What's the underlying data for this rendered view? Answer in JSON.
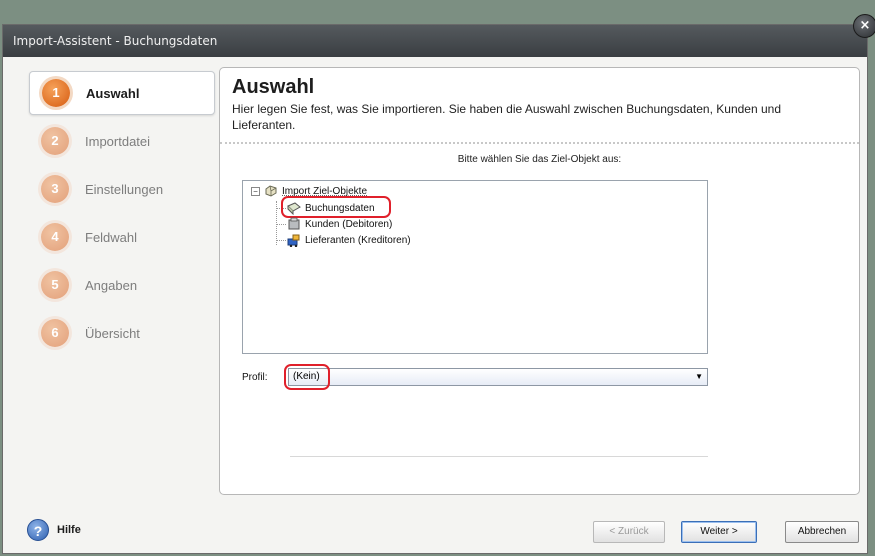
{
  "window": {
    "title": "Import-Assistent - Buchungsdaten",
    "close_glyph": "×"
  },
  "sidebar": {
    "steps": [
      {
        "number": "1",
        "label": "Auswahl",
        "state": "active"
      },
      {
        "number": "2",
        "label": "Importdatei",
        "state": "inactive"
      },
      {
        "number": "3",
        "label": "Einstellungen",
        "state": "inactive"
      },
      {
        "number": "4",
        "label": "Feldwahl",
        "state": "inactive"
      },
      {
        "number": "5",
        "label": "Angaben",
        "state": "inactive"
      },
      {
        "number": "6",
        "label": "Übersicht",
        "state": "inactive"
      }
    ]
  },
  "main": {
    "title": "Auswahl",
    "description": "Hier legen Sie fest, was Sie importieren. Sie haben die Auswahl zwischen Buchungsdaten, Kunden und Lieferanten.",
    "instruction": "Bitte wählen Sie das Ziel-Objekt aus:",
    "tree": {
      "root": {
        "label": "Import Ziel-Objekte",
        "icon": "puzzle-icon",
        "expander": "−"
      },
      "children": [
        {
          "label": "Buchungsdaten",
          "icon": "book-icon",
          "selected": true
        },
        {
          "label": "Kunden (Debitoren)",
          "icon": "customer-icon",
          "selected": false
        },
        {
          "label": "Lieferanten (Kreditoren)",
          "icon": "supplier-icon",
          "selected": false
        }
      ]
    },
    "profil": {
      "label": "Profil:",
      "value": "(Kein)",
      "arrow": "▼"
    }
  },
  "footer": {
    "help_label": "Hilfe",
    "help_glyph": "?",
    "back_label": "< Zurück",
    "next_label": "Weiter >",
    "cancel_label": "Abbrechen"
  },
  "colors": {
    "accent_active": "#d65b10",
    "highlight": "#e0202b"
  }
}
